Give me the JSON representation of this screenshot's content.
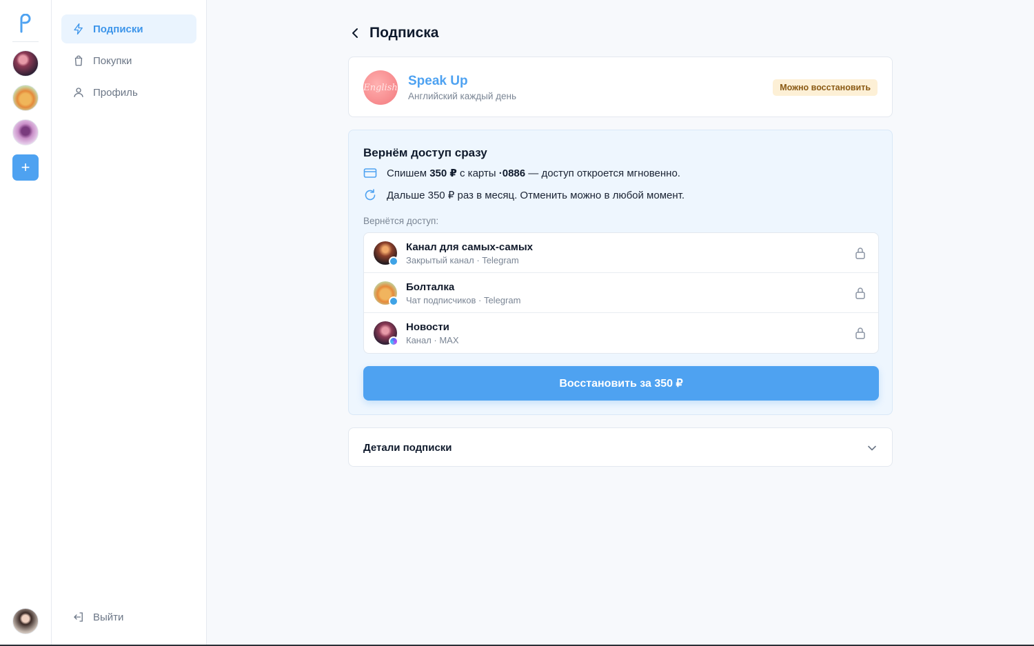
{
  "rail": {
    "logo": "p-logo-icon",
    "add_label": "+"
  },
  "nav": {
    "items": [
      {
        "label": "Подписки",
        "icon": "lightning-icon",
        "active": true
      },
      {
        "label": "Покупки",
        "icon": "bag-icon",
        "active": false
      },
      {
        "label": "Профиль",
        "icon": "user-icon",
        "active": false
      }
    ],
    "logout_label": "Выйти"
  },
  "page": {
    "title": "Подписка"
  },
  "subscription": {
    "logo_text": "English",
    "name": "Speak Up",
    "description": "Английский каждый день",
    "status_badge": "Можно восстановить"
  },
  "restore": {
    "title": "Вернём доступ сразу",
    "line1_prefix": "Спишем ",
    "line1_amount": "350 ₽",
    "line1_mid": " с карты ",
    "line1_card": "·0886",
    "line1_suffix": " — доступ откроется мгновенно.",
    "line2": "Дальше 350 ₽ раз в месяц. Отменить можно в любой момент.",
    "access_label": "Вернётся доступ:",
    "items": [
      {
        "name": "Канал для самых-самых",
        "sub": "Закрытый канал · Telegram"
      },
      {
        "name": "Болталка",
        "sub": "Чат подписчиков · Telegram"
      },
      {
        "name": "Новости",
        "sub": "Канал · MAX"
      }
    ],
    "button_label": "Восстановить за 350 ₽"
  },
  "details": {
    "title": "Детали подписки"
  },
  "colors": {
    "accent": "#4ea2f1",
    "badge_bg": "#fdf0d6",
    "badge_text": "#8a5a14"
  }
}
